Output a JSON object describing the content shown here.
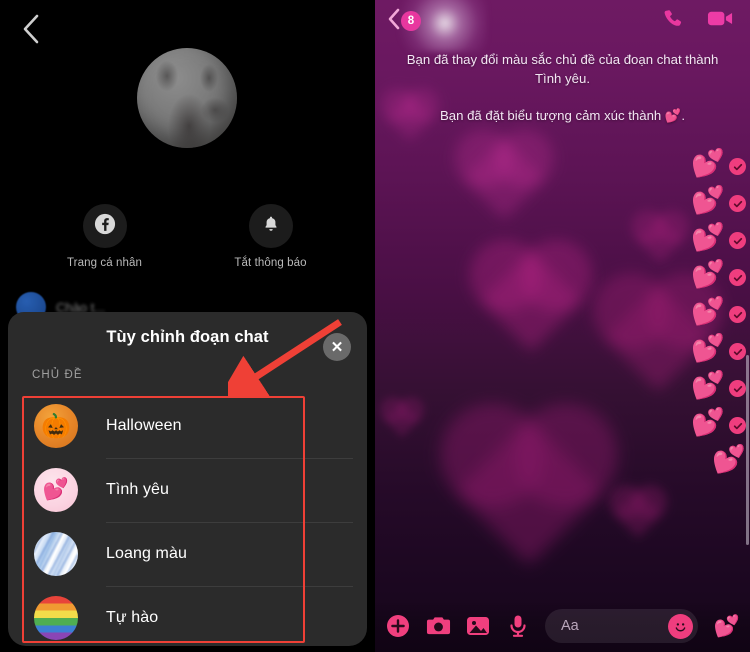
{
  "left_panel": {
    "back_icon": "chevron-left-icon",
    "avatar": "profile-avatar",
    "quick_actions": [
      {
        "icon": "facebook-icon",
        "label": "Trang cá nhân"
      },
      {
        "icon": "bell-icon",
        "label": "Tắt thông báo"
      }
    ],
    "behind_text": "Chào t...",
    "sheet": {
      "title": "Tùy chỉnh đoạn chat",
      "close_label": "✕",
      "section_label": "CHỦ ĐỀ",
      "themes": [
        {
          "name": "Halloween",
          "thumb": "pumpkin-thumb"
        },
        {
          "name": "Tình yêu",
          "thumb": "hearts-thumb"
        },
        {
          "name": "Loang màu",
          "thumb": "tiedye-thumb"
        },
        {
          "name": "Tự hào",
          "thumb": "rainbow-thumb"
        }
      ]
    },
    "annotation": {
      "color": "#ef4036",
      "box_name": "highlight-box",
      "arrow_name": "pointer-arrow"
    }
  },
  "right_panel": {
    "topbar": {
      "back_icon": "chevron-left-icon",
      "unread_badge": "8",
      "avatar": "conversation-avatar",
      "call_icon": "phone-icon",
      "video_icon": "video-camera-icon",
      "accent_color": "#e8379f"
    },
    "system_messages": [
      "Bạn đã thay đổi màu sắc chủ đề của đoạn chat thành Tình yêu.",
      "Bạn đã đặt biểu tượng cảm xúc thành 💕."
    ],
    "messages": [
      {
        "emoji": "💕",
        "status": "sent"
      },
      {
        "emoji": "💕",
        "status": "sent"
      },
      {
        "emoji": "💕",
        "status": "sent"
      },
      {
        "emoji": "💕",
        "status": "sent"
      },
      {
        "emoji": "💕",
        "status": "sent"
      },
      {
        "emoji": "💕",
        "status": "sent"
      },
      {
        "emoji": "💕",
        "status": "sent"
      },
      {
        "emoji": "💕",
        "status": "sent"
      },
      {
        "emoji": "💕",
        "status": "sent"
      }
    ],
    "composer": {
      "icons": [
        "plus-icon",
        "camera-icon",
        "gallery-icon",
        "microphone-icon"
      ],
      "input_placeholder": "Aa",
      "emoji_button": "smiley-icon",
      "send_sticker": "💕"
    },
    "theme_name": "Tình yêu"
  }
}
